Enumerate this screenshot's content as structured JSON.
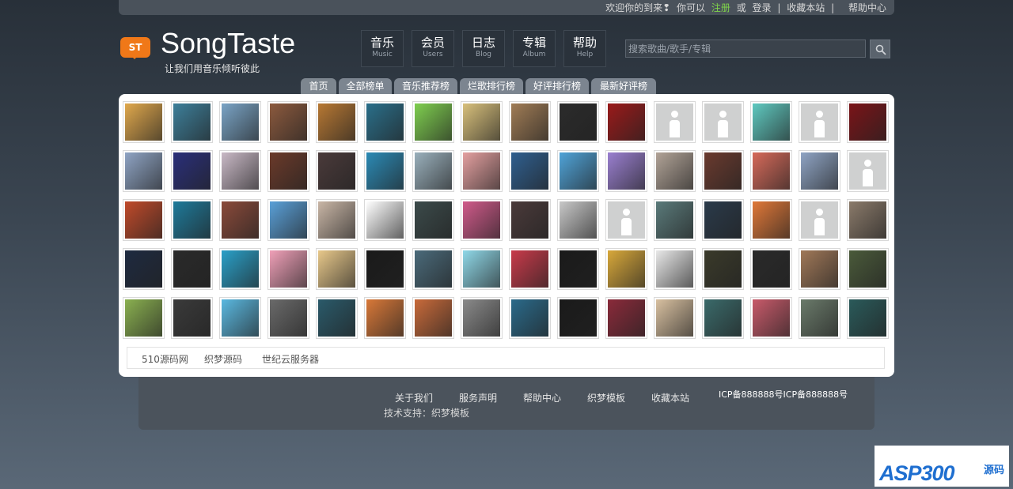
{
  "topbar": {
    "welcome": "欢迎你的到来❢",
    "can": "你可以",
    "register": "注册",
    "or": "或",
    "login": "登录",
    "sep": "|",
    "favorite": "收藏本站",
    "sep2": "|",
    "help": "帮助中心"
  },
  "logo": {
    "badge": "ST",
    "name": "SongTaste",
    "slogan": "让我们用音乐倾听彼此"
  },
  "nav": [
    {
      "zh": "音乐",
      "en": "Music"
    },
    {
      "zh": "会员",
      "en": "Users"
    },
    {
      "zh": "日志",
      "en": "Blog"
    },
    {
      "zh": "专辑",
      "en": "Album"
    },
    {
      "zh": "帮助",
      "en": "Help"
    }
  ],
  "search": {
    "placeholder": "搜索歌曲/歌手/专辑"
  },
  "tabs": [
    "首页",
    "全部榜单",
    "音乐推荐榜",
    "烂歌排行榜",
    "好评排行榜",
    "最新好评榜"
  ],
  "colors": {
    "accent_orange": "#f07818",
    "register_green": "#7fd34a",
    "panel_bg": "#ffffff"
  },
  "gallery": {
    "columns": 16,
    "rows": 5,
    "cells": [
      "#e0a84c",
      "#3d7f9a",
      "#7aa4c6",
      "#8c5a3e",
      "#b77833",
      "#2a6f8a",
      "#7fcf4f",
      "#d8c07b",
      "#a07c55",
      "#2b2b2b",
      "#9a1a1a",
      "ph",
      "ph",
      "#5fc9c0",
      "ph",
      "#7a1418",
      "#8fa4c4",
      "#2a2f7a",
      "#c9b9c6",
      "#6b3a2a",
      "#4a3a3a",
      "#2b8ab5",
      "#9ab0bc",
      "#e4a0a0",
      "#2f5f8f",
      "#4fa3d8",
      "#9a7fd0",
      "#b1a397",
      "#6a3a2e",
      "#d66a5a",
      "#8fa4c4",
      "ph",
      "#c04a2a",
      "#1e7a9a",
      "#8a4a3a",
      "#5aa0d8",
      "#c9b6a6",
      "#ffffff",
      "#3b4a4a",
      "#d05a8a",
      "#4a3a3a",
      "#c8c8c8",
      "ph",
      "#5a7a7a",
      "#2a3a4a",
      "#e07838",
      "ph",
      "#8a7a6a",
      "#1e2a40",
      "#2a2a2a",
      "#2aa0c8",
      "#f0a0b8",
      "#e8c88a",
      "#1a1a1a",
      "#4a6a7a",
      "#8fd8e8",
      "#c83a4a",
      "#1a1a1a",
      "#d8a83a",
      "#e8e8e8",
      "#3a3a2a",
      "#2a2a2a",
      "#a07858",
      "#4a5a3a",
      "#8ab050",
      "#3a3a3a",
      "#5ab8e0",
      "#6a6a6a",
      "#2a5a6a",
      "#d87838",
      "#c86a3a",
      "#8a8a8a",
      "#2a6a8a",
      "#1a1a1a",
      "#8a2a3a",
      "#d8c0a0",
      "#3a6a6a",
      "#c85a6a",
      "#6a7a6a",
      "#2a5a5a"
    ]
  },
  "friend_links": [
    "510源码网",
    "织梦源码",
    "世纪云服务器"
  ],
  "footer": {
    "links": [
      "关于我们",
      "服务声明",
      "帮助中心",
      "织梦模板",
      "收藏本站"
    ],
    "icp": "ICP备888888号ICP备888888号",
    "tech": "技术支持：织梦模板"
  },
  "watermark": {
    "main": "ASP300",
    "suffix": "源码"
  }
}
